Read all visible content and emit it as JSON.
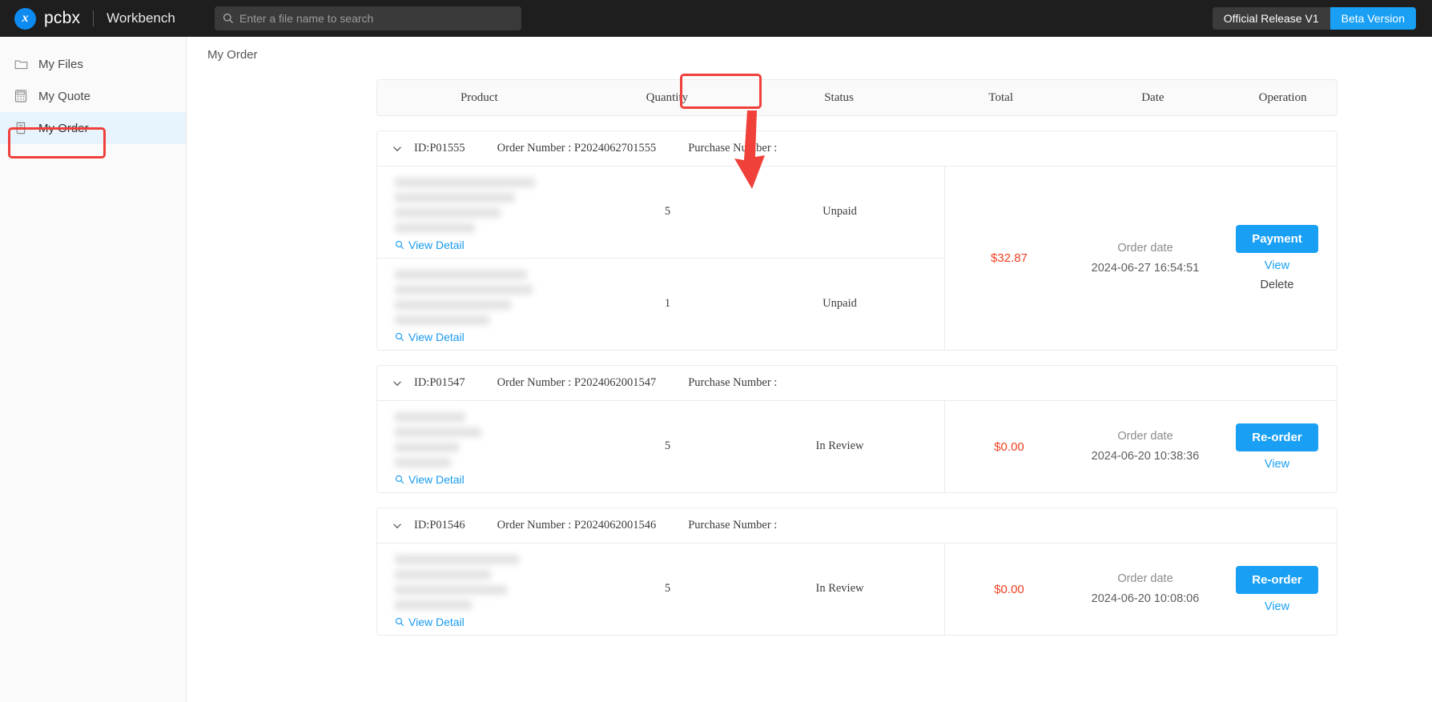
{
  "topbar": {
    "logo_glyph": "x",
    "brand": "pcbx",
    "workbench": "Workbench",
    "search_placeholder": "Enter a file name to search",
    "search_value": "",
    "official_release": "Official Release V1",
    "beta_version": "Beta Version"
  },
  "sidebar": {
    "items": [
      {
        "label": "My Files",
        "icon": "folder-icon",
        "active": false
      },
      {
        "label": "My Quote",
        "icon": "calculator-icon",
        "active": false
      },
      {
        "label": "My Order",
        "icon": "order-document-icon",
        "active": true
      }
    ]
  },
  "breadcrumb": "My Order",
  "table": {
    "headers": [
      "Product",
      "Quantity",
      "Status",
      "Total",
      "Date",
      "Operation"
    ],
    "order_date_label": "Order date",
    "view_detail_label": "View Detail",
    "id_prefix": "ID:",
    "order_number_label": "Order Number : ",
    "purchase_number_label": "Purchase Number :"
  },
  "orders": [
    {
      "id": "ID:P01555",
      "order_number": "Order Number : P2024062701555",
      "purchase_number": "Purchase Number :",
      "lines": [
        {
          "product": "",
          "quantity": "5",
          "status": "Unpaid",
          "view_detail": "View Detail"
        },
        {
          "product": "",
          "quantity": "1",
          "status": "Unpaid",
          "view_detail": "View Detail"
        }
      ],
      "total": "$32.87",
      "date_label": "Order date",
      "date_value": "2024-06-27 16:54:51",
      "actions": [
        {
          "label": "Payment",
          "type": "primary"
        },
        {
          "label": "View",
          "type": "link-blue"
        },
        {
          "label": "Delete",
          "type": "link-dark"
        }
      ]
    },
    {
      "id": "ID:P01547",
      "order_number": "Order Number : P2024062001547",
      "purchase_number": "Purchase Number :",
      "lines": [
        {
          "product": "",
          "quantity": "5",
          "status": "In Review",
          "view_detail": "View Detail"
        }
      ],
      "total": "$0.00",
      "date_label": "Order date",
      "date_value": "2024-06-20 10:38:36",
      "actions": [
        {
          "label": "Re-order",
          "type": "primary"
        },
        {
          "label": "View",
          "type": "link-blue"
        }
      ]
    },
    {
      "id": "ID:P01546",
      "order_number": "Order Number : P2024062001546",
      "purchase_number": "Purchase Number :",
      "lines": [
        {
          "product": "",
          "quantity": "5",
          "status": "In Review",
          "view_detail": "View Detail"
        }
      ],
      "total": "$0.00",
      "date_label": "Order date",
      "date_value": "2024-06-20 10:08:06",
      "actions": [
        {
          "label": "Re-order",
          "type": "primary"
        },
        {
          "label": "View",
          "type": "link-blue"
        }
      ]
    }
  ],
  "annotations": {
    "color": "#f0403a",
    "highlight_sidebar_item": "My Order",
    "highlight_column": "Status",
    "arrow": "down-arrow"
  }
}
